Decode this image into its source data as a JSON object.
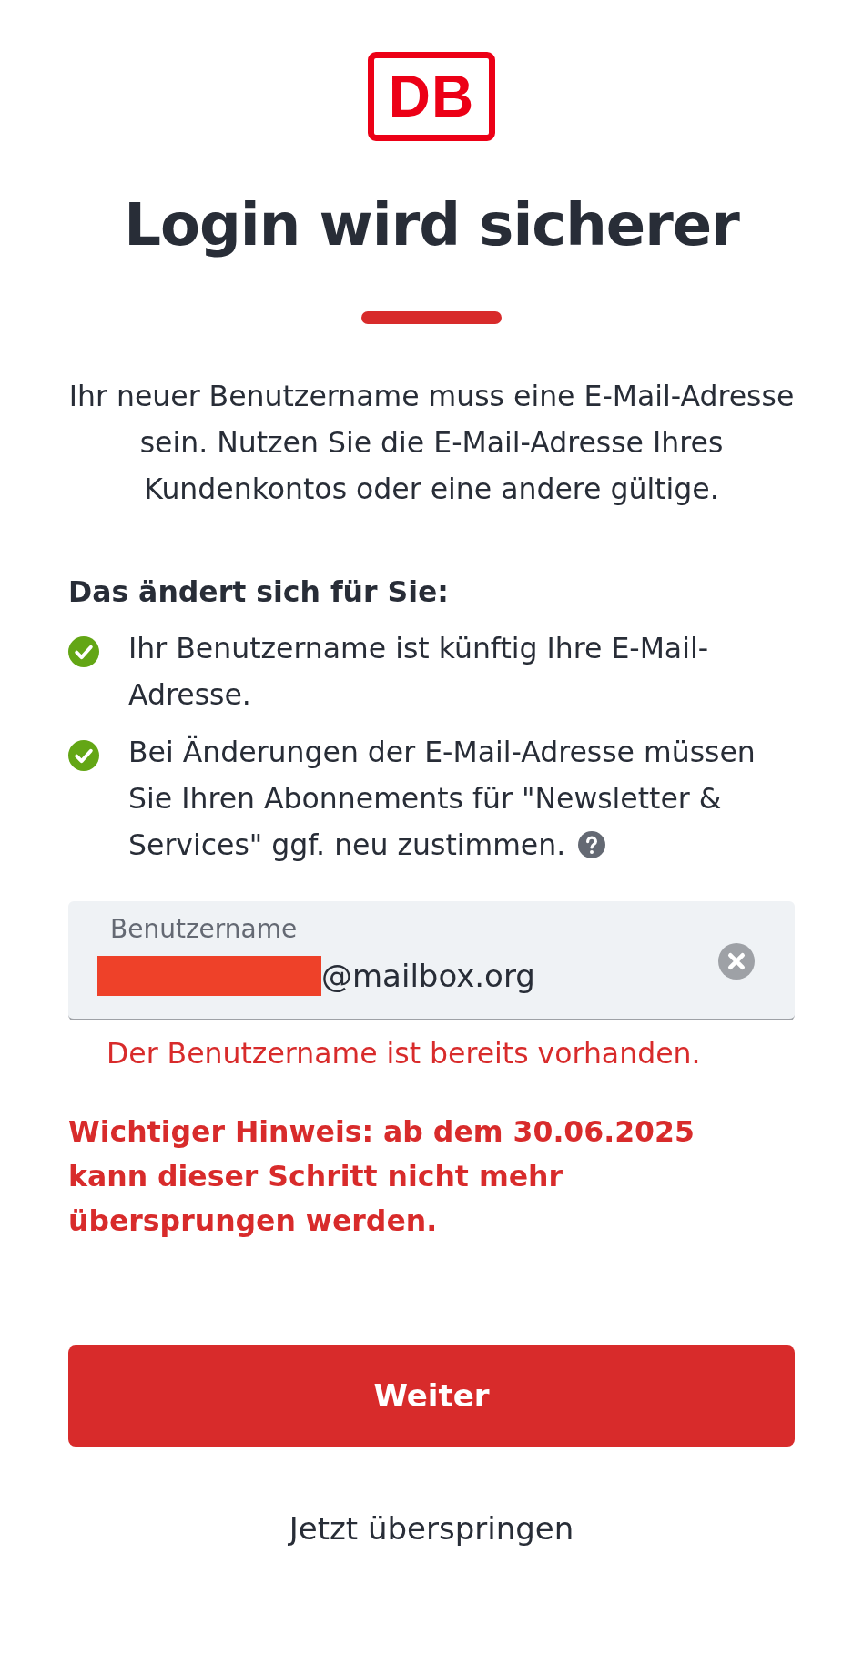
{
  "logo": {
    "text": "DB"
  },
  "title": "Login wird sicherer",
  "intro": "Ihr neuer Benutzername muss eine E-Mail-Adresse sein. Nutzen Sie die E-Mail-Adresse Ihres Kundenkontos oder eine andere gültige.",
  "changes": {
    "heading": "Das ändert sich für Sie:",
    "items": [
      {
        "text": "Ihr Benutzername ist künftig Ihre E-Mail-Adresse.",
        "help": false
      },
      {
        "text": "Bei Änderungen der E-Mail-Adresse müssen Sie Ihren Abonnements für \"Newsletter & Services\" ggf. neu zustimmen.",
        "help": true
      }
    ]
  },
  "username_field": {
    "label": "Benutzername",
    "value": "@mailbox.org",
    "redacted": true,
    "error": "Der Benutzername ist bereits vorhanden."
  },
  "notice": "Wichtiger Hinweis: ab dem 30.06.2025 kann dieser Schritt nicht mehr übersprungen werden.",
  "buttons": {
    "primary": "Weiter",
    "skip": "Jetzt überspringen"
  }
}
